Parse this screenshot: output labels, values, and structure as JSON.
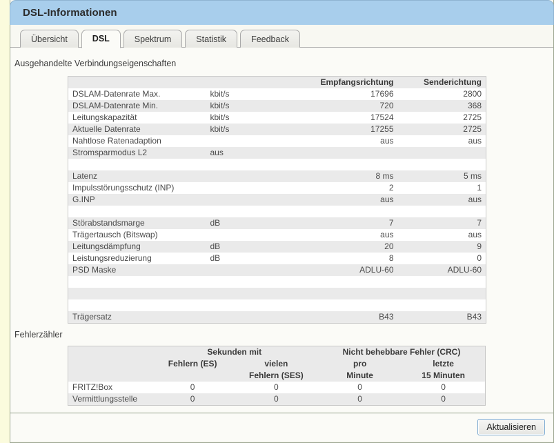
{
  "window": {
    "title": "DSL-Informationen"
  },
  "tabs": [
    {
      "label": "Übersicht",
      "active": false
    },
    {
      "label": "DSL",
      "active": true
    },
    {
      "label": "Spektrum",
      "active": false
    },
    {
      "label": "Statistik",
      "active": false
    },
    {
      "label": "Feedback",
      "active": false
    }
  ],
  "connection": {
    "section_title": "Ausgehandelte Verbindungseigenschaften",
    "headers": {
      "name": "",
      "unit": "",
      "downstream": "Empfangsrichtung",
      "upstream": "Senderichtung"
    },
    "rows": [
      {
        "name": "DSLAM-Datenrate Max.",
        "unit": "kbit/s",
        "down": "17696",
        "up": "2800"
      },
      {
        "name": "DSLAM-Datenrate Min.",
        "unit": "kbit/s",
        "down": "720",
        "up": "368"
      },
      {
        "name": "Leitungskapazität",
        "unit": "kbit/s",
        "down": "17524",
        "up": "2725"
      },
      {
        "name": "Aktuelle Datenrate",
        "unit": "kbit/s",
        "down": "17255",
        "up": "2725"
      },
      {
        "name": "Nahtlose Ratenadaption",
        "unit": "",
        "down": "aus",
        "up": "aus"
      },
      {
        "name": "Stromsparmodus L2",
        "unit": "aus",
        "down": "",
        "up": ""
      },
      {
        "name": "",
        "unit": "",
        "down": "",
        "up": ""
      },
      {
        "name": "Latenz",
        "unit": "",
        "down": "8 ms",
        "up": "5 ms"
      },
      {
        "name": "Impulsstörungsschutz (INP)",
        "unit": "",
        "down": "2",
        "up": "1"
      },
      {
        "name": "G.INP",
        "unit": "",
        "down": "aus",
        "up": "aus"
      },
      {
        "name": "",
        "unit": "",
        "down": "",
        "up": ""
      },
      {
        "name": "Störabstandsmarge",
        "unit": "dB",
        "down": "7",
        "up": "7"
      },
      {
        "name": "Trägertausch (Bitswap)",
        "unit": "",
        "down": "aus",
        "up": "aus"
      },
      {
        "name": "Leitungsdämpfung",
        "unit": "dB",
        "down": "20",
        "up": "9"
      },
      {
        "name": "Leistungsreduzierung",
        "unit": "dB",
        "down": "8",
        "up": "0"
      },
      {
        "name": "PSD Maske",
        "unit": "",
        "down": "ADLU-60",
        "up": "ADLU-60"
      },
      {
        "name": "",
        "unit": "",
        "down": "",
        "up": ""
      },
      {
        "name": "",
        "unit": "",
        "down": "",
        "up": ""
      },
      {
        "name": "",
        "unit": "",
        "down": "",
        "up": ""
      },
      {
        "name": "Trägersatz",
        "unit": "",
        "down": "B43",
        "up": "B43"
      }
    ]
  },
  "errors": {
    "section_title": "Fehlerzähler",
    "group_headers": {
      "seconds": "Sekunden mit",
      "crc": "Nicht behebbare Fehler (CRC)"
    },
    "sub_headers": [
      {
        "line1": "Fehlern (ES)",
        "line2": ""
      },
      {
        "line1": "vielen",
        "line2": "Fehlern (SES)"
      },
      {
        "line1": "pro",
        "line2": "Minute"
      },
      {
        "line1": "letzte",
        "line2": "15 Minuten"
      }
    ],
    "rows": [
      {
        "name": "FRITZ!Box",
        "es": "0",
        "ses": "0",
        "crc_min": "0",
        "crc_15": "0"
      },
      {
        "name": "Vermittlungsstelle",
        "es": "0",
        "ses": "0",
        "crc_min": "0",
        "crc_15": "0"
      }
    ]
  },
  "footer": {
    "refresh_label": "Aktualisieren"
  },
  "colors": {
    "titlebar": "#a8ceec",
    "page_background": "#fbfbdd",
    "content_background": "#fbfbf7",
    "row_stripe": "#eaeaea",
    "table_border": "#c8c8c8",
    "button_border": "#7aa8cf"
  }
}
